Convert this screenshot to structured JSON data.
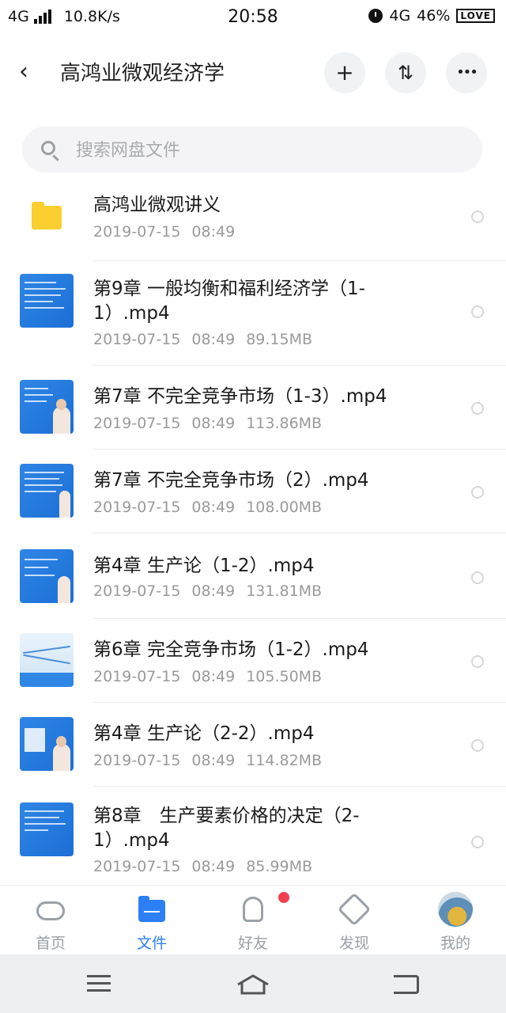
{
  "status_bar": {
    "network": "4G",
    "speed": "10.8K/s",
    "time": "20:58",
    "network_right": "4G",
    "battery": "46%",
    "badge": "LOVE"
  },
  "header": {
    "title": "高鸿业微观经济学",
    "back_icon": "‹",
    "add_icon": "+",
    "sort_icon": "⇅",
    "more_icon": "•••"
  },
  "search": {
    "placeholder": "搜索网盘文件"
  },
  "files": [
    {
      "type": "folder",
      "name": "高鸿业微观讲义",
      "date": "2019-07-15",
      "time": "08:49",
      "size": ""
    },
    {
      "type": "video",
      "name": "第9章 一般均衡和福利经济学（1-1）.mp4",
      "date": "2019-07-15",
      "time": "08:49",
      "size": "89.15MB"
    },
    {
      "type": "video",
      "name": "第7章 不完全竞争市场（1-3）.mp4",
      "date": "2019-07-15",
      "time": "08:49",
      "size": "113.86MB"
    },
    {
      "type": "video",
      "name": "第7章 不完全竞争市场（2）.mp4",
      "date": "2019-07-15",
      "time": "08:49",
      "size": "108.00MB"
    },
    {
      "type": "video",
      "name": "第4章 生产论（1-2）.mp4",
      "date": "2019-07-15",
      "time": "08:49",
      "size": "131.81MB"
    },
    {
      "type": "video",
      "name": "第6章 完全竞争市场（1-2）.mp4",
      "date": "2019-07-15",
      "time": "08:49",
      "size": "105.50MB"
    },
    {
      "type": "video",
      "name": "第4章 生产论（2-2）.mp4",
      "date": "2019-07-15",
      "time": "08:49",
      "size": "114.82MB"
    },
    {
      "type": "video",
      "name": "第8章　生产要素价格的决定（2-1）.mp4",
      "date": "2019-07-15",
      "time": "08:49",
      "size": "85.99MB"
    }
  ],
  "bottom_nav": {
    "home": "首页",
    "files": "文件",
    "friends": "好友",
    "discover": "发现",
    "me": "我的"
  },
  "colors": {
    "accent": "#2c7ff5",
    "folder": "#fbcf2f",
    "badge": "#f0404d"
  }
}
